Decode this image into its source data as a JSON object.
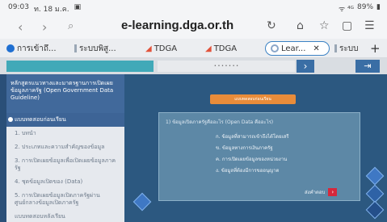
{
  "status_bar": {
    "time": "09:03",
    "date": "ท. 18 ม.ค.",
    "battery": "89%",
    "signal": "ᯤ ⁴ᴳ"
  },
  "address_bar": {
    "url": "e-learning.dga.or.th"
  },
  "tabs": [
    {
      "label": "การเข้าถึ...",
      "color": "#1f6fd1"
    },
    {
      "label": "ระบบพิสู...",
      "color": "#9aa7b5"
    },
    {
      "label": "TDGA",
      "color": "#e2533b"
    },
    {
      "label": "TDGA",
      "color": "#e2533b"
    },
    {
      "label": "Lear...",
      "color": "#8aa6c9",
      "active": true
    },
    {
      "label": "ระบบ",
      "color": "#9aa7b5"
    }
  ],
  "course": {
    "title": "หลักสูตรแนวทางและมาตรฐานการเปิดเผยข้อมูลภาครัฐ (Open Government Data Guideline)",
    "items": [
      "แบบทดสอบก่อนเรียน",
      "1. บทนำ",
      "2. ประเภทและความสำคัญของข้อมูล",
      "3. การเปิดเผยข้อมูลเพื่อเปิดเผยข้อมูลภาครัฐ",
      "4. ชุดข้อมูลเปิดของ (Data)",
      "5. การเปิดเผยข้อมูลเปิดภาครัฐผ่านศูนย์กลางข้อมูลเปิดภาครัฐ",
      "แบบทดสอบหลังเรียน"
    ]
  },
  "quiz": {
    "header": "แบบทดสอบก่อนเรียน",
    "question": "1) ข้อมูลเปิดภาครัฐคืออะไร (Open Data คืออะไร)",
    "options": [
      "ก. ข้อมูลที่สามารถเข้าถึงได้โดยเสรี",
      "ข. ข้อมูลทางการเงินภาครัฐ",
      "ค. การเปิดเผยข้อมูลของหน่วยงาน",
      "ง. ข้อมูลที่ต้องมีการขออนุญาต"
    ],
    "submit_label": "ส่งคำตอบ"
  }
}
